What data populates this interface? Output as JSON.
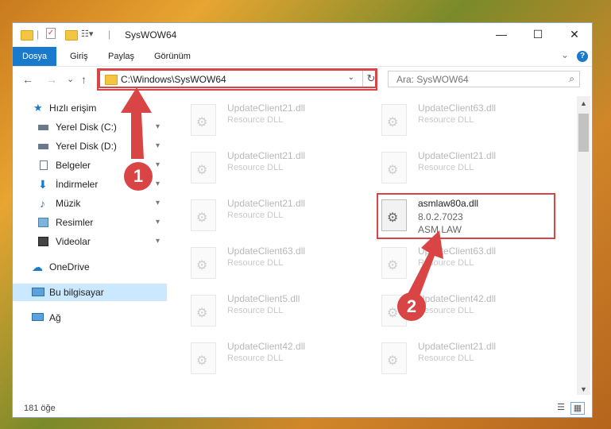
{
  "window": {
    "title": "SysWOW64",
    "controls": {
      "minimize": "—",
      "maximize": "☐",
      "close": "✕"
    }
  },
  "ribbon": {
    "tabs": [
      "Dosya",
      "Giriş",
      "Paylaş",
      "Görünüm"
    ],
    "expand_icon": "⌄",
    "help_icon": "?"
  },
  "nav": {
    "back": "←",
    "forward": "→",
    "recent": "⌄",
    "up": "↑",
    "address": "C:\\Windows\\SysWOW64",
    "address_dropdown": "⌄",
    "refresh": "↻",
    "search_placeholder": "Ara: SysWOW64",
    "search_icon": "⌕"
  },
  "sidebar": {
    "items": [
      {
        "label": "Hızlı erişim",
        "icon": "star-icon",
        "pinned": false
      },
      {
        "label": "Yerel Disk (C:)",
        "icon": "drive-icon",
        "pinned": true
      },
      {
        "label": "Yerel Disk (D:)",
        "icon": "drive-icon",
        "pinned": true
      },
      {
        "label": "Belgeler",
        "icon": "documents-icon",
        "pinned": true
      },
      {
        "label": "İndirmeler",
        "icon": "download-icon",
        "pinned": true
      },
      {
        "label": "Müzik",
        "icon": "music-icon",
        "pinned": true
      },
      {
        "label": "Resimler",
        "icon": "pictures-icon",
        "pinned": true
      },
      {
        "label": "Videolar",
        "icon": "videos-icon",
        "pinned": true
      },
      {
        "label": "OneDrive",
        "icon": "cloud-icon",
        "pinned": false
      },
      {
        "label": "Bu bilgisayar",
        "icon": "computer-icon",
        "pinned": false
      },
      {
        "label": "Ağ",
        "icon": "network-icon",
        "pinned": false
      }
    ],
    "pin_glyph": "📌"
  },
  "files": [
    {
      "name": "UpdateClient21.dll",
      "desc": "Resource DLL"
    },
    {
      "name": "UpdateClient63.dll",
      "desc": "Resource DLL"
    },
    {
      "name": "UpdateClient21.dll",
      "desc": "Resource DLL"
    },
    {
      "name": "UpdateClient21.dll",
      "desc": "Resource DLL"
    },
    {
      "name": "UpdateClient21.dll",
      "desc": "Resource DLL"
    },
    {
      "name": "asmlaw80a.dll",
      "version": "8.0.2.7023",
      "company": "ASM LAW"
    },
    {
      "name": "UpdateClient63.dll",
      "desc": "Resource DLL"
    },
    {
      "name": "UpdateClient63.dll",
      "desc": "Resource DLL"
    },
    {
      "name": "UpdateClient5.dll",
      "desc": "Resource DLL"
    },
    {
      "name": "UpdateClient42.dll",
      "desc": "Resource DLL"
    },
    {
      "name": "UpdateClient42.dll",
      "desc": "Resource DLL"
    },
    {
      "name": "UpdateClient21.dll",
      "desc": "Resource DLL"
    }
  ],
  "status": {
    "item_count": "181 öğe"
  },
  "annotations": {
    "step1": "1",
    "step2": "2",
    "color": "#d94545"
  }
}
